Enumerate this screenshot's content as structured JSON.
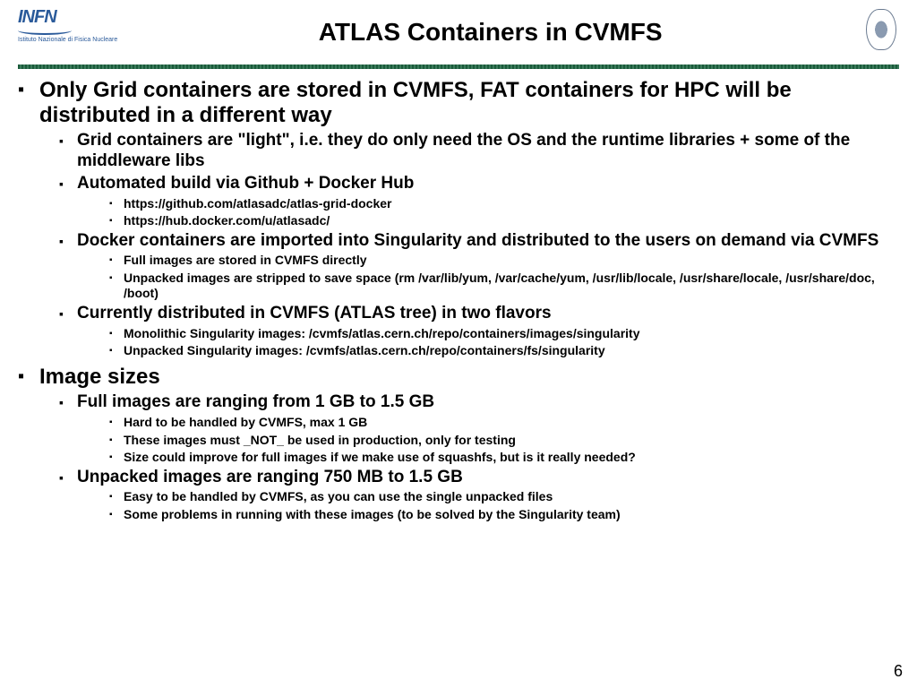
{
  "header": {
    "logo_left_text": "INFN",
    "logo_left_sub": "Istituto Nazionale di Fisica Nucleare",
    "title": "ATLAS Containers in CVMFS"
  },
  "bullets": [
    {
      "text": "Only Grid containers are stored in CVMFS, FAT containers for HPC will be distributed in a different way",
      "children": [
        {
          "text": "Grid containers are \"light\", i.e. they do only need the OS and the runtime libraries + some of the middleware libs"
        },
        {
          "text": "Automated build via Github + Docker Hub",
          "children": [
            {
              "text": "https://github.com/atlasadc/atlas-grid-docker"
            },
            {
              "text": "https://hub.docker.com/u/atlasadc/"
            }
          ]
        },
        {
          "text": "Docker containers are imported into Singularity and distributed to the users on demand via CVMFS",
          "children": [
            {
              "text": "Full images are stored in CVMFS directly"
            },
            {
              "text": "Unpacked images are stripped to save space (rm /var/lib/yum, /var/cache/yum, /usr/lib/locale, /usr/share/locale, /usr/share/doc, /boot)"
            }
          ]
        },
        {
          "text": "Currently distributed in CVMFS (ATLAS tree) in two flavors",
          "children": [
            {
              "text": "Monolithic Singularity images: /cvmfs/atlas.cern.ch/repo/containers/images/singularity"
            },
            {
              "text": "Unpacked Singularity images: /cvmfs/atlas.cern.ch/repo/containers/fs/singularity"
            }
          ]
        }
      ]
    },
    {
      "text": "Image sizes",
      "children": [
        {
          "text": "Full images are ranging from 1 GB to 1.5 GB",
          "children": [
            {
              "text": "Hard to be handled by CVMFS, max 1 GB"
            },
            {
              "text": "These images must _NOT_ be used in production, only for testing"
            },
            {
              "text": "Size could improve for full images if we make use of squashfs, but is it really needed?"
            }
          ]
        },
        {
          "text": "Unpacked images are ranging 750 MB to 1.5 GB",
          "children": [
            {
              "text": "Easy to be handled by CVMFS, as you can use the single unpacked files"
            },
            {
              "text": "Some problems in running with these images (to be solved by the Singularity team)"
            }
          ]
        }
      ]
    }
  ],
  "page_number": "6"
}
